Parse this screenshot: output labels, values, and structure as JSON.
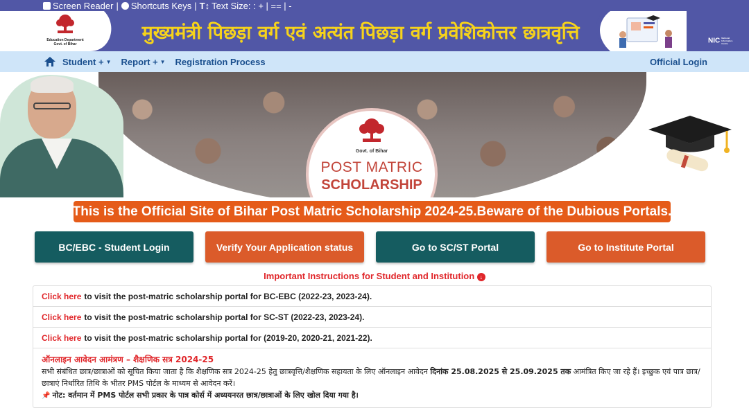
{
  "topbar": {
    "screen_reader": "Screen Reader",
    "sep1": "|",
    "shortcuts": "Shortcuts Keys",
    "sep2": "|",
    "text_size": "Text Size: : + | == | -"
  },
  "header": {
    "logo_dept": "Education Department",
    "logo_gov": "Govt. of Bihar",
    "title": "मुख्यमंत्री पिछड़ा वर्ग एवं अत्यंत पिछड़ा वर्ग प्रवेशिकोत्तर छात्रवृत्ति",
    "nic": "NIC",
    "nic_sub": "National Informatics Centre"
  },
  "nav": {
    "items": [
      {
        "label": "Student +"
      },
      {
        "label": "Report +"
      },
      {
        "label": "Registration Process"
      }
    ],
    "login": "Official Login"
  },
  "hero": {
    "emblem_gov": "Govt. of Bihar",
    "line1": "POST MATRIC",
    "line2": "SCHOLARSHIP"
  },
  "notice": "This is the Official Site of Bihar Post Matric Scholarship 2024-25.Beware of the Dubious Portals.",
  "buttons": [
    {
      "label": "BC/EBC - Student Login",
      "color": "#155c60"
    },
    {
      "label": "Verify Your Application status",
      "color": "#db5b2a"
    },
    {
      "label": "Go to SC/ST Portal",
      "color": "#155c60"
    },
    {
      "label": "Go to Institute Portal",
      "color": "#db5b2a"
    }
  ],
  "instructions": "Important Instructions for Student and Institution",
  "links": [
    {
      "link": "Click here",
      "text": "to visit the post-matric scholarship portal for BC-EBC (2022-23, 2023-24)."
    },
    {
      "link": "Click here",
      "text": "to visit the post-matric scholarship portal for SC-ST (2022-23, 2023-24)."
    },
    {
      "link": "Click here",
      "text": "to visit the post-matric scholarship portal for (2019-20, 2020-21, 2021-22)."
    }
  ],
  "announcement": {
    "heading": "ऑनलाइन आवेदन आमंत्रण – शैक्षणिक सत्र 2024-25",
    "body1": "सभी संबंधित छात्र/छात्राओं को सूचित किया जाता है कि शैक्षणिक सत्र 2024-25 हेतु छात्रवृत्ति/शैक्षणिक सहायता के लिए ऑनलाइन आवेदन",
    "dates": "दिनांक 25.08.2025 से 25.09.2025 तक",
    "body2": "आमंत्रित किए जा रहे हैं। इच्छुक एवं पात्र छात्र/छात्राएं निर्धारित तिथि के भीतर PMS पोर्टल के माध्यम से आवेदन करें।",
    "note": "नोट: वर्तमान में PMS पोर्टल सभी प्रकार के पात्र कोर्स में अध्ययनरत छात्र/छात्राओं के लिए खोल दिया गया है।"
  }
}
